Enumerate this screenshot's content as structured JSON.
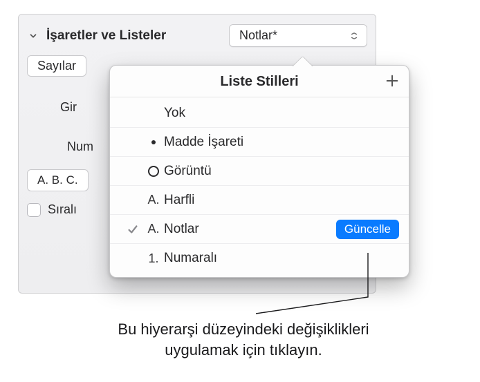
{
  "section": {
    "title": "İşaretler ve Listeler",
    "dropdown_value": "Notlar*",
    "numbers_label": "Sayılar",
    "indent_prefix": "Gir",
    "label_num": "Num",
    "numbering_value": "A. B. C.",
    "ordered_label": "Sıralı"
  },
  "popover": {
    "title": "Liste Stilleri",
    "items": [
      {
        "marker": "",
        "label": "Yok",
        "selected": false
      },
      {
        "marker": "dot",
        "label": "Madde İşareti",
        "selected": false
      },
      {
        "marker": "ring",
        "label": "Görüntü",
        "selected": false
      },
      {
        "marker": "A.",
        "label": "Harfli",
        "selected": false
      },
      {
        "marker": "A.",
        "label": "Notlar",
        "selected": true,
        "update": true
      },
      {
        "marker": "1.",
        "label": "Numaralı",
        "selected": false
      }
    ],
    "update_label": "Güncelle"
  },
  "callout": {
    "line1": "Bu hiyerarşi düzeyindeki değişiklikleri",
    "line2": "uygulamak için tıklayın."
  }
}
